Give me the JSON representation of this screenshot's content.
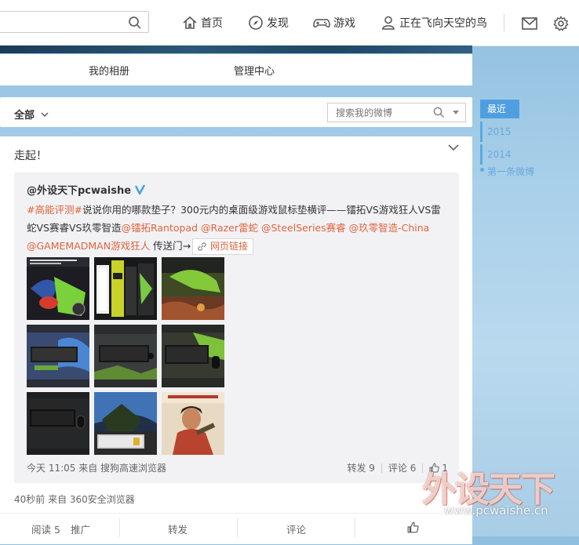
{
  "header": {
    "nav": [
      {
        "label": "首页",
        "icon": "home-icon"
      },
      {
        "label": "发现",
        "icon": "compass-icon"
      },
      {
        "label": "游戏",
        "icon": "gamepad-icon"
      },
      {
        "label": "正在飞向天空的鸟",
        "icon": "user-icon"
      }
    ]
  },
  "profile_tabs": [
    "我的相册",
    "管理中心"
  ],
  "filter": {
    "all_label": "全部",
    "search_placeholder": "搜索我的微博"
  },
  "timeline": {
    "current": "最近",
    "years": [
      "2015",
      "2014"
    ],
    "first": "第一条微博"
  },
  "post": {
    "text": "走起！",
    "repost": {
      "author": "@外设天下pcwaishe",
      "hashtag": "#高能评测#",
      "body1": "说说你用的哪款垫子？300元内的桌面级游戏鼠标垫横评——镭拓VS游戏狂人VS雷蛇VS赛睿VS玖零智造",
      "mentions": [
        "@镭拓Rantopad",
        "@Razer雷蛇",
        "@SteelSeries赛睿",
        "@玖零智造-China",
        "@GAMEMADMAN游戏狂人"
      ],
      "tail": "传送门→",
      "link_label": "网页链接",
      "meta": "今天 11:05 来自 搜狗高速浏览器",
      "forward": "转发 9",
      "comment": "评论 6",
      "like": "1"
    },
    "meta": "40秒前 来自 360安全浏览器",
    "actions": {
      "read": "阅读 5",
      "promote": "推广",
      "forward": "转发",
      "comment": "评论"
    }
  },
  "watermark": {
    "title": "外设天下",
    "url": "www.pcwaishe.cn"
  },
  "colors": {
    "accent": "#4f9fe0",
    "link": "#e0643c"
  }
}
